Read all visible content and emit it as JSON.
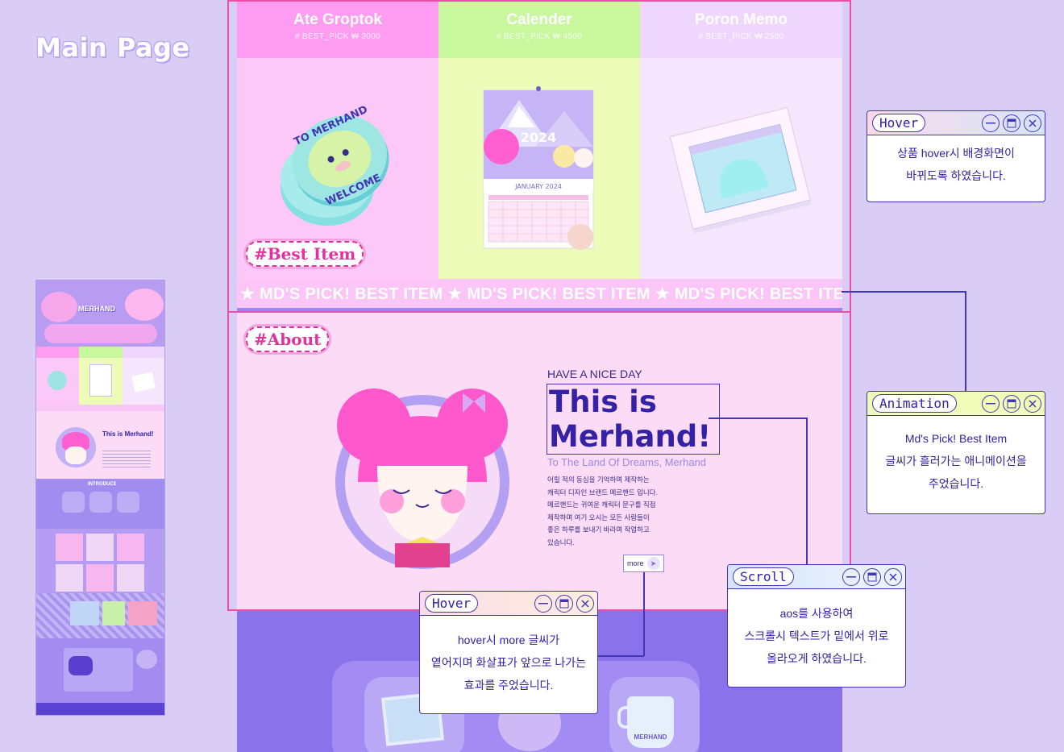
{
  "page_title": "Main Page",
  "products": [
    {
      "name": "Ate Groptok",
      "meta": "# BEST_PICK   ₩ 3000",
      "head_color": "#fd9cf0",
      "body_color": "#fcc8f7"
    },
    {
      "name": "Calender",
      "meta": "# BEST_PICK   ₩ 4500",
      "head_color": "#c8f79e",
      "body_color": "#ecfcb8"
    },
    {
      "name": "Poron Memo",
      "meta": "# BEST_PICK   ₩ 2500",
      "head_color": "#efd6fc",
      "body_color": "#f6e6fd"
    }
  ],
  "best_item_tag": "#Best Item",
  "marquee_text": "★ MD'S PICK! BEST ITEM ★ MD'S PICK! BEST ITEM ★ MD'S PICK! BEST ITEM",
  "about": {
    "tag": "#About",
    "eyebrow": "HAVE A NICE DAY",
    "headline_1": "This is",
    "headline_2": "Merhand!",
    "subline": "To The Land Of Dreams, Merhand",
    "body": [
      "어릴 적의 동심을 기억하며 제작하는",
      "캐릭터 디자인 브랜드 메르핸드 입니다.",
      "메르핸드는 귀여운 캐릭터 문구를 직접",
      "제작하며 여기 오시는 모든 사람들이",
      "좋은 하루를 보내기 바라며 작업하고",
      "있습니다."
    ],
    "more_label": "more"
  },
  "merch": {
    "popsocket_text": "WELCOME TO MERHAND",
    "calendar_year": "2024",
    "calendar_month": "JANUARY 2024",
    "mug_text": "MERHAND"
  },
  "annotations": {
    "hover_top": {
      "label": "Hover",
      "lines": [
        "상품 hover시 배경화면이",
        "바뀌도록 하였습니다."
      ]
    },
    "animation": {
      "label": "Animation",
      "lines": [
        "Md's Pick! Best Item",
        "글씨가 흘러가는 애니메이션을",
        "주었습니다."
      ]
    },
    "scroll": {
      "label": "Scroll",
      "lines": [
        "aos를 사용하여",
        "스크롤시 텍스트가 밑에서 위로",
        "올라오게 하였습니다."
      ]
    },
    "hover_more": {
      "label": "Hover",
      "lines": [
        "hover시 more 글씨가",
        "옅어지며 화살표가 앞으로 나가는",
        "효과를 주었습니다."
      ]
    }
  },
  "thumbnail": {
    "logo": "MERHAND",
    "section_introduce": "INTRODUCE",
    "headline": "This is Merhand!"
  },
  "colors": {
    "background": "#d9cdf5",
    "accent_outline": "#ea4fa6",
    "ink": "#3322a6",
    "pink_tag": "#e0329d"
  }
}
